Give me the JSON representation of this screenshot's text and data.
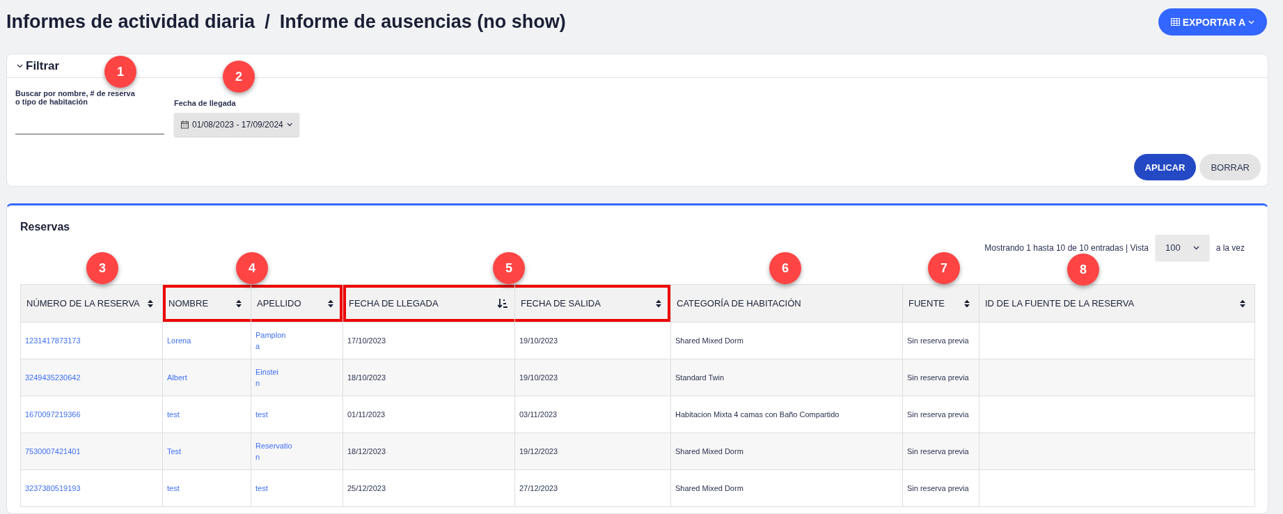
{
  "breadcrumb": [
    "Informes de actividad diaria",
    "/",
    "Informe de ausencias (no show)"
  ],
  "export_button": {
    "label": "EXPORTAR A"
  },
  "filter": {
    "title": "Filtrar",
    "expanded": true,
    "search": {
      "label": "Buscar por nombre, # de reserva o tipo de habitación"
    },
    "date": {
      "label": "Fecha de llegada",
      "value": "01/08/2023 - 17/09/2024"
    },
    "buttons": [
      {
        "label": "APLICAR",
        "kind": "primary"
      },
      {
        "label": "BORRAR",
        "kind": "secondary"
      }
    ]
  },
  "reservations": {
    "title": "Reservas",
    "info": "Mostrando 1 hasta 10 de 10 entradas | Vista",
    "page_size": "100",
    "page_size_suffix": "a la vez",
    "columns": [
      {
        "label": "NÚMERO DE LA RESERVA",
        "sortable": true,
        "sorted_ascending": false,
        "link": true,
        "framed": false
      },
      {
        "label": "NOMBRE",
        "sortable": true,
        "sorted_ascending": false,
        "link": true,
        "framed": true,
        "frame_start": true
      },
      {
        "label": "APELLIDO",
        "sortable": true,
        "sorted_ascending": false,
        "link": true,
        "framed": true,
        "frame_start": false
      },
      {
        "label": "FECHA DE LLEGADA",
        "sortable": true,
        "sorted_ascending": true,
        "link": false,
        "framed": true,
        "frame_start": true
      },
      {
        "label": "FECHA DE SALIDA",
        "sortable": true,
        "sorted_ascending": false,
        "link": false,
        "framed": true,
        "frame_start": false
      },
      {
        "label": "CATEGORÍA DE HABITACIÓN",
        "sortable": false,
        "link": false,
        "framed": false
      },
      {
        "label": "FUENTE",
        "sortable": true,
        "sorted_ascending": false,
        "link": false,
        "framed": false
      },
      {
        "label": "ID DE LA FUENTE DE LA RESERVA",
        "sortable": true,
        "sorted_ascending": false,
        "link": false,
        "framed": false
      }
    ],
    "rows": [
      [
        "1231417873173",
        "Lorena",
        "Pamplon\na",
        "17/10/2023",
        "19/10/2023",
        "Shared Mixed Dorm",
        "Sin reserva previa",
        ""
      ],
      [
        "3249435230642",
        "Albert",
        "Einstei\nn",
        "18/10/2023",
        "19/10/2023",
        "Standard Twin",
        "Sin reserva previa",
        ""
      ],
      [
        "1670097219366",
        "test",
        "test",
        "01/11/2023",
        "03/11/2023",
        "Habitacion Mixta 4 camas con Baño Compartido",
        "Sin reserva previa",
        ""
      ],
      [
        "7530007421401",
        "Test",
        "Reservatio\nn",
        "18/12/2023",
        "19/12/2023",
        "Shared Mixed Dorm",
        "Sin reserva previa",
        ""
      ],
      [
        "3237380519193",
        "test",
        "test",
        "25/12/2023",
        "27/12/2023",
        "Shared Mixed Dorm",
        "Sin reserva previa",
        ""
      ]
    ]
  },
  "annotations": {
    "badges": [
      "1",
      "2",
      "3",
      "4",
      "5",
      "6",
      "7",
      "8"
    ]
  }
}
